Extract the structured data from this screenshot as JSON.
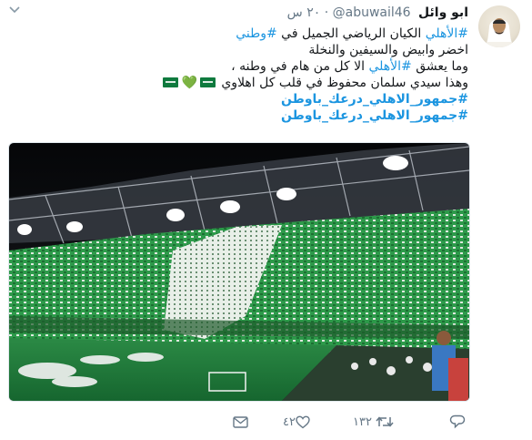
{
  "tweet": {
    "author_name": "ابو وائل",
    "handle": "@abuwail46",
    "separator": "·",
    "time": "٢٠ س",
    "line1": {
      "tag1": "#الأهلي",
      "text": " الكيان الرياضي الجميل في ",
      "tag2": "#وطني"
    },
    "line2": "اخضر وابيض والسيفين والنخلة",
    "line3": {
      "pre": "وما يعشق ",
      "tag": "#الأهلي",
      "post": " الا كل من هام في وطنه ،"
    },
    "line4": "وهذا سيدي سلمان محفوظ في قلب كل اهلاوي",
    "hashtag_line1": "#جمهور_الاهلي_درعك_باوطن",
    "hashtag_line2": "#جمهور_الاهلي_درعك_باوطن",
    "emoji_heart": "💚"
  },
  "actions": {
    "reply_count": "",
    "retweet_count": "١٣٢",
    "like_count": "٤٢"
  },
  "icons": {
    "menu": "chevron-down-icon",
    "reply": "reply-icon",
    "retweet": "retweet-icon",
    "like": "heart-icon",
    "message": "envelope-icon"
  },
  "colors": {
    "link": "#1b95e0",
    "muted": "#657786",
    "pitch": "#1f7a3a",
    "crowd_green": "#2d9a4a"
  }
}
